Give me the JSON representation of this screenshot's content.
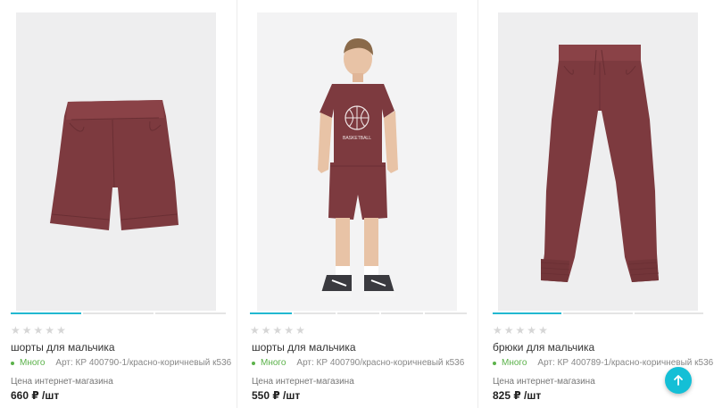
{
  "products": [
    {
      "title": "шорты для мальчика",
      "stock": "Много",
      "article": "Арт: КР 400790-1/красно-коричневый к536",
      "price_label": "Цена интернет-магазина",
      "price": "660 ₽ /шт",
      "rating": 0,
      "image_icon": "shorts-image"
    },
    {
      "title": "шорты для мальчика",
      "stock": "Много",
      "article": "Арт: КР 400790/красно-коричневый к536",
      "price_label": "Цена интернет-магазина",
      "price": "550 ₽ /шт",
      "rating": 0,
      "image_icon": "boy-model-image",
      "print_text": "BASKETBALL"
    },
    {
      "title": "брюки для мальчика",
      "stock": "Много",
      "article": "Арт: КР 400789-1/красно-коричневый к536",
      "price_label": "Цена интернет-магазина",
      "price": "825 ₽ /шт",
      "rating": 0,
      "image_icon": "pants-image"
    }
  ],
  "scroll_top_icon": "arrow-up-icon",
  "colors": {
    "accent": "#14bfd6",
    "stock": "#5bb24a",
    "garment": "#7d3a3f",
    "image_bg": "#eeeeef"
  }
}
